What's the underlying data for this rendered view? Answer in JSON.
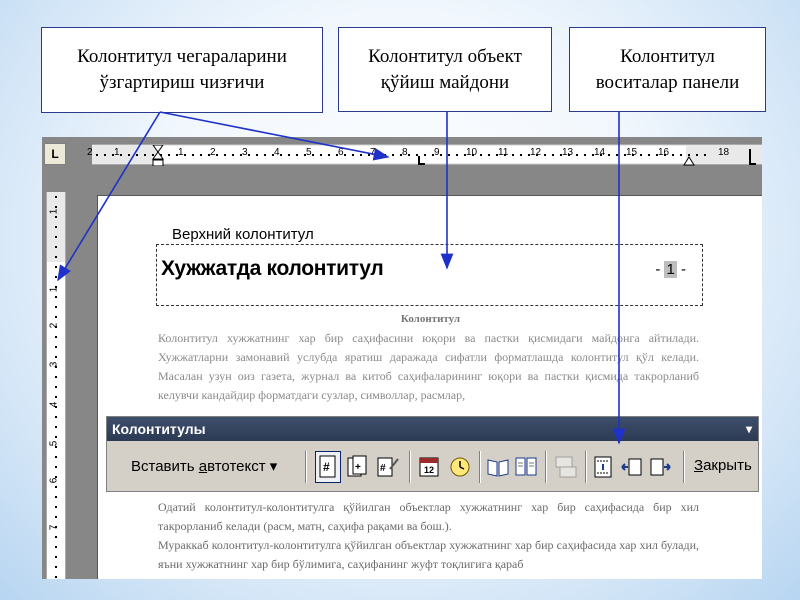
{
  "callouts": {
    "left": [
      "Колонтитул чегараларини",
      "ўзгартириш чизғичи"
    ],
    "middle": [
      "Колонтитул объект",
      "қўйиш майдони"
    ],
    "right": [
      "Колонтитул",
      "воситалар панели"
    ]
  },
  "ruler": {
    "corner_label": "L",
    "h_labels": [
      "2",
      "1",
      "1",
      "2",
      "3",
      "4",
      "5",
      "6",
      "7",
      "8",
      "9",
      "10",
      "11",
      "12",
      "13",
      "14",
      "15",
      "16",
      "18"
    ],
    "v_labels": [
      "1",
      "1",
      "2",
      "3",
      "4",
      "5",
      "6",
      "7"
    ]
  },
  "header": {
    "label": "Верхний колонтитул",
    "title": "Хужжатда колонтитул",
    "page_number_prefix": "- ",
    "page_number": "1",
    "page_number_suffix": " -"
  },
  "document": {
    "title": "Колонтитул",
    "paragraph1": "Колонтитул хужжатнинг хар бир саҳифасини юқори ва пастки қисмидаги майдонга айтилади. Хужжатларни замонавий услубда яратиш даражада сифатли форматлашда колонтитул қўл келади. Масалан узун оиз газета, журнал ва китоб саҳифаларининг юқори ва пастки қисмида такрорланиб келувчи кандайдир форматдаги сузлар, символлар, расмлар,",
    "paragraph2": "Одатий колонтитул-колонтитулга қўйилган объектлар хужжатнинг хар бир саҳифасида бир хил такрорланиб келади (расм, матн, саҳифа рақами ва бош.).",
    "paragraph3": "Мураккаб колонтитул-колонтитулга қўйилган объектлар хужжатнинг хар бир саҳифасида хар хил булади, яъни хужжатнинг хар бир бўлимига, саҳифанинг жуфт тоқлигига қараб"
  },
  "toolbar": {
    "title": "Колонтитулы",
    "autotext_prefix": "Вставить ",
    "autotext_underlined": "а",
    "autotext_rest": "втотекст",
    "autotext_caret": "▾",
    "close_underlined": "З",
    "close_rest": "акрыть",
    "menu_caret": "▾"
  },
  "colors": {
    "arrow": "#1f31c9",
    "toolbar_title_bg": "#2c3a54",
    "callout_border": "#2a3a8c"
  }
}
